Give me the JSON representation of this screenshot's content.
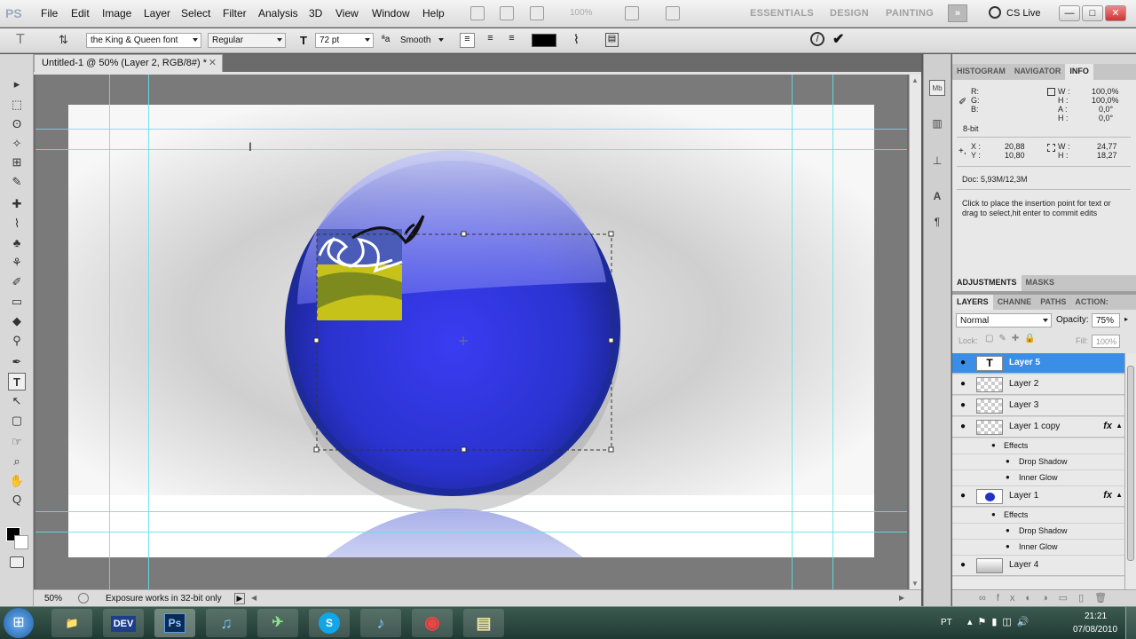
{
  "app": {
    "logo": "PS"
  },
  "menu": [
    "File",
    "Edit",
    "Image",
    "Layer",
    "Select",
    "Filter",
    "Analysis",
    "3D",
    "View",
    "Window",
    "Help"
  ],
  "zoom_box": "100%",
  "workspaces": [
    "ESSENTIALS",
    "DESIGN",
    "PAINTING"
  ],
  "cslive": "CS Live",
  "window_buttons": [
    "—",
    "□",
    "✕"
  ],
  "options": {
    "tool_glyph": "T",
    "font_family": "the King & Queen font",
    "font_style": "Regular",
    "font_size": "72 pt",
    "aa_glyph": "ªa",
    "antialias": "Smooth",
    "text_color": "#000000"
  },
  "document": {
    "tab_title": "Untitled-1 @ 50% (Layer 2, RGB/8#) *",
    "tab_close": "✕",
    "zoom": "50%",
    "status": "Exposure works in 32-bit only"
  },
  "tools": [
    "▸",
    "⬚",
    "ʘ",
    "✧",
    "⊞",
    "✎",
    "✚",
    "⌇",
    "♣",
    "⚘",
    "✐",
    "▭",
    "◆",
    "⚲",
    "✒",
    "T",
    "↖",
    "▢",
    "☞",
    "⌕",
    "Q"
  ],
  "info_panel": {
    "tabs": [
      "HISTOGRAM",
      "NAVIGATOR",
      "INFO"
    ],
    "rgb": [
      "R:",
      "G:",
      "B:"
    ],
    "bit": "8-bit",
    "wh_labels": [
      "W :",
      "H :",
      "A :",
      "H :"
    ],
    "wh_values": [
      "100,0%",
      "100,0%",
      "0,0°",
      "0,0°"
    ],
    "xy_labels": [
      "X :",
      "Y :"
    ],
    "xy_values": [
      "20,88",
      "10,80"
    ],
    "size_labels": [
      "W :",
      "H :"
    ],
    "size_values": [
      "24,77",
      "18,27"
    ],
    "doc": "Doc: 5,93M/12,3M",
    "hint": "Click to place the insertion point for text or drag to select,hit enter to commit edits"
  },
  "adjustments_tabs": [
    "ADJUSTMENTS",
    "MASKS"
  ],
  "layers_panel": {
    "tabs": [
      "LAYERS",
      "CHANNE",
      "PATHS",
      "ACTION:"
    ],
    "blend": "Normal",
    "opacity_label": "Opacity:",
    "opacity": "75%",
    "lock_label": "Lock:",
    "fill_label": "Fill:",
    "fill": "100%",
    "layers": [
      {
        "name": "Layer 5",
        "selected": true,
        "type": "text",
        "thumb_glyph": "T"
      },
      {
        "name": "Layer 2"
      },
      {
        "name": "Layer 3"
      },
      {
        "name": "Layer 1 copy",
        "fx": "fx",
        "effects_label": "Effects",
        "effects": [
          "Drop Shadow",
          "Inner Glow"
        ]
      },
      {
        "name": "Layer 1",
        "fx": "fx",
        "effects_label": "Effects",
        "effects": [
          "Drop Shadow",
          "Inner Glow"
        ]
      },
      {
        "name": "Layer 4"
      }
    ]
  },
  "taskbar": {
    "items": [
      "⊞",
      "📁",
      "DEV",
      "Ps",
      "♫",
      "✈",
      "S",
      "♪",
      "◉",
      "▤"
    ],
    "lang": "PT",
    "time": "21:21",
    "date": "07/08/2010"
  },
  "colors": {
    "accent": "#3a8ee6",
    "guide": "#5ee3ec",
    "sphere": "#2233c8"
  }
}
